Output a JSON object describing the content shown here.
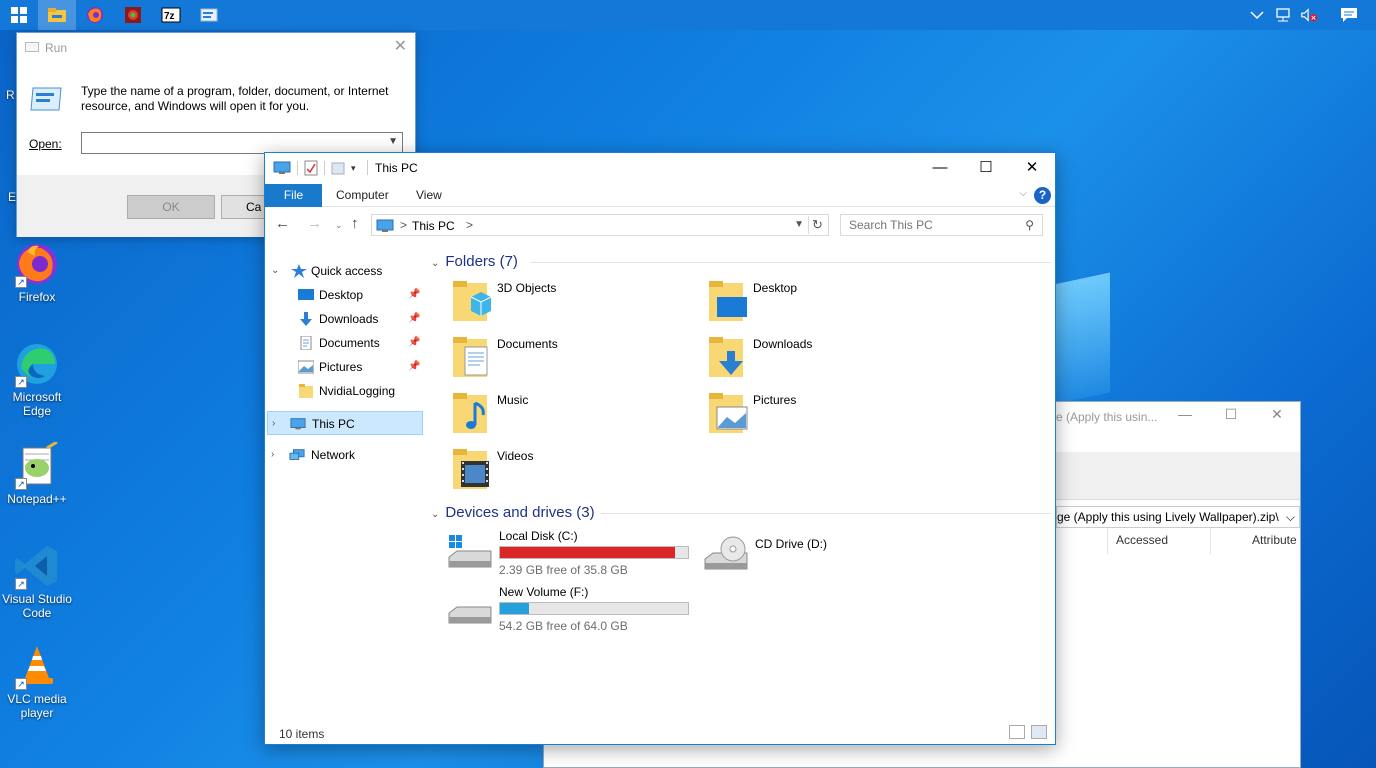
{
  "desktop": {
    "icons": [
      {
        "label": "Firefox",
        "icon": "firefox-icon"
      },
      {
        "label": "Microsoft Edge",
        "icon": "edge-icon"
      },
      {
        "label": "Notepad++",
        "icon": "notepadpp-icon"
      },
      {
        "label": "Visual Studio Code",
        "icon": "vscode-icon"
      },
      {
        "label": "VLC media player",
        "icon": "vlc-icon"
      }
    ],
    "partial_labels": [
      "R",
      "E"
    ]
  },
  "taskbar": {
    "apps": [
      "windows-start-icon",
      "file-explorer-icon",
      "firefox-icon",
      "chrome-like-icon",
      "7zip-icon",
      "run-icon"
    ],
    "seven_zip_label": "7z",
    "tray": [
      "chevron-up-icon",
      "network-icon",
      "volume-muted-icon",
      "notifications-icon"
    ]
  },
  "run_dialog": {
    "title": "Run",
    "description": "Type the name of a program, folder, document, or Internet resource, and Windows will open it for you.",
    "open_label": "Open:",
    "open_value": "",
    "ok_label": "OK",
    "cancel_label": "Ca"
  },
  "background_window": {
    "title": "e (Apply this usin...",
    "address": "ge (Apply this using Lively Wallpaper).zip\\",
    "columns": [
      "Accessed",
      "Attribute"
    ]
  },
  "explorer": {
    "title": "This PC",
    "ribbon_tabs": [
      "File",
      "Computer",
      "View"
    ],
    "help": "?",
    "address": {
      "crumb": "This PC",
      "sep": ">"
    },
    "search_placeholder": "Search This PC",
    "nav": {
      "quick_access": "Quick access",
      "items": [
        {
          "label": "Desktop",
          "pinned": true
        },
        {
          "label": "Downloads",
          "pinned": true
        },
        {
          "label": "Documents",
          "pinned": true
        },
        {
          "label": "Pictures",
          "pinned": true
        },
        {
          "label": "NvidiaLogging",
          "pinned": false
        }
      ],
      "this_pc": "This PC",
      "network": "Network"
    },
    "folders_header": "Folders (7)",
    "folders": [
      {
        "name": "3D Objects"
      },
      {
        "name": "Desktop"
      },
      {
        "name": "Documents"
      },
      {
        "name": "Downloads"
      },
      {
        "name": "Music"
      },
      {
        "name": "Pictures"
      },
      {
        "name": "Videos"
      }
    ],
    "devices_header": "Devices and drives (3)",
    "drives": [
      {
        "name": "Local Disk (C:)",
        "free": "2.39 GB free of 35.8 GB",
        "used_fraction": 0.933,
        "bar_color": "#da2626"
      },
      {
        "name": "New Volume (F:)",
        "free": "54.2 GB free of 64.0 GB",
        "used_fraction": 0.153,
        "bar_color": "#26a0da"
      },
      {
        "name": "CD Drive (D:)"
      }
    ],
    "status": "10 items"
  }
}
